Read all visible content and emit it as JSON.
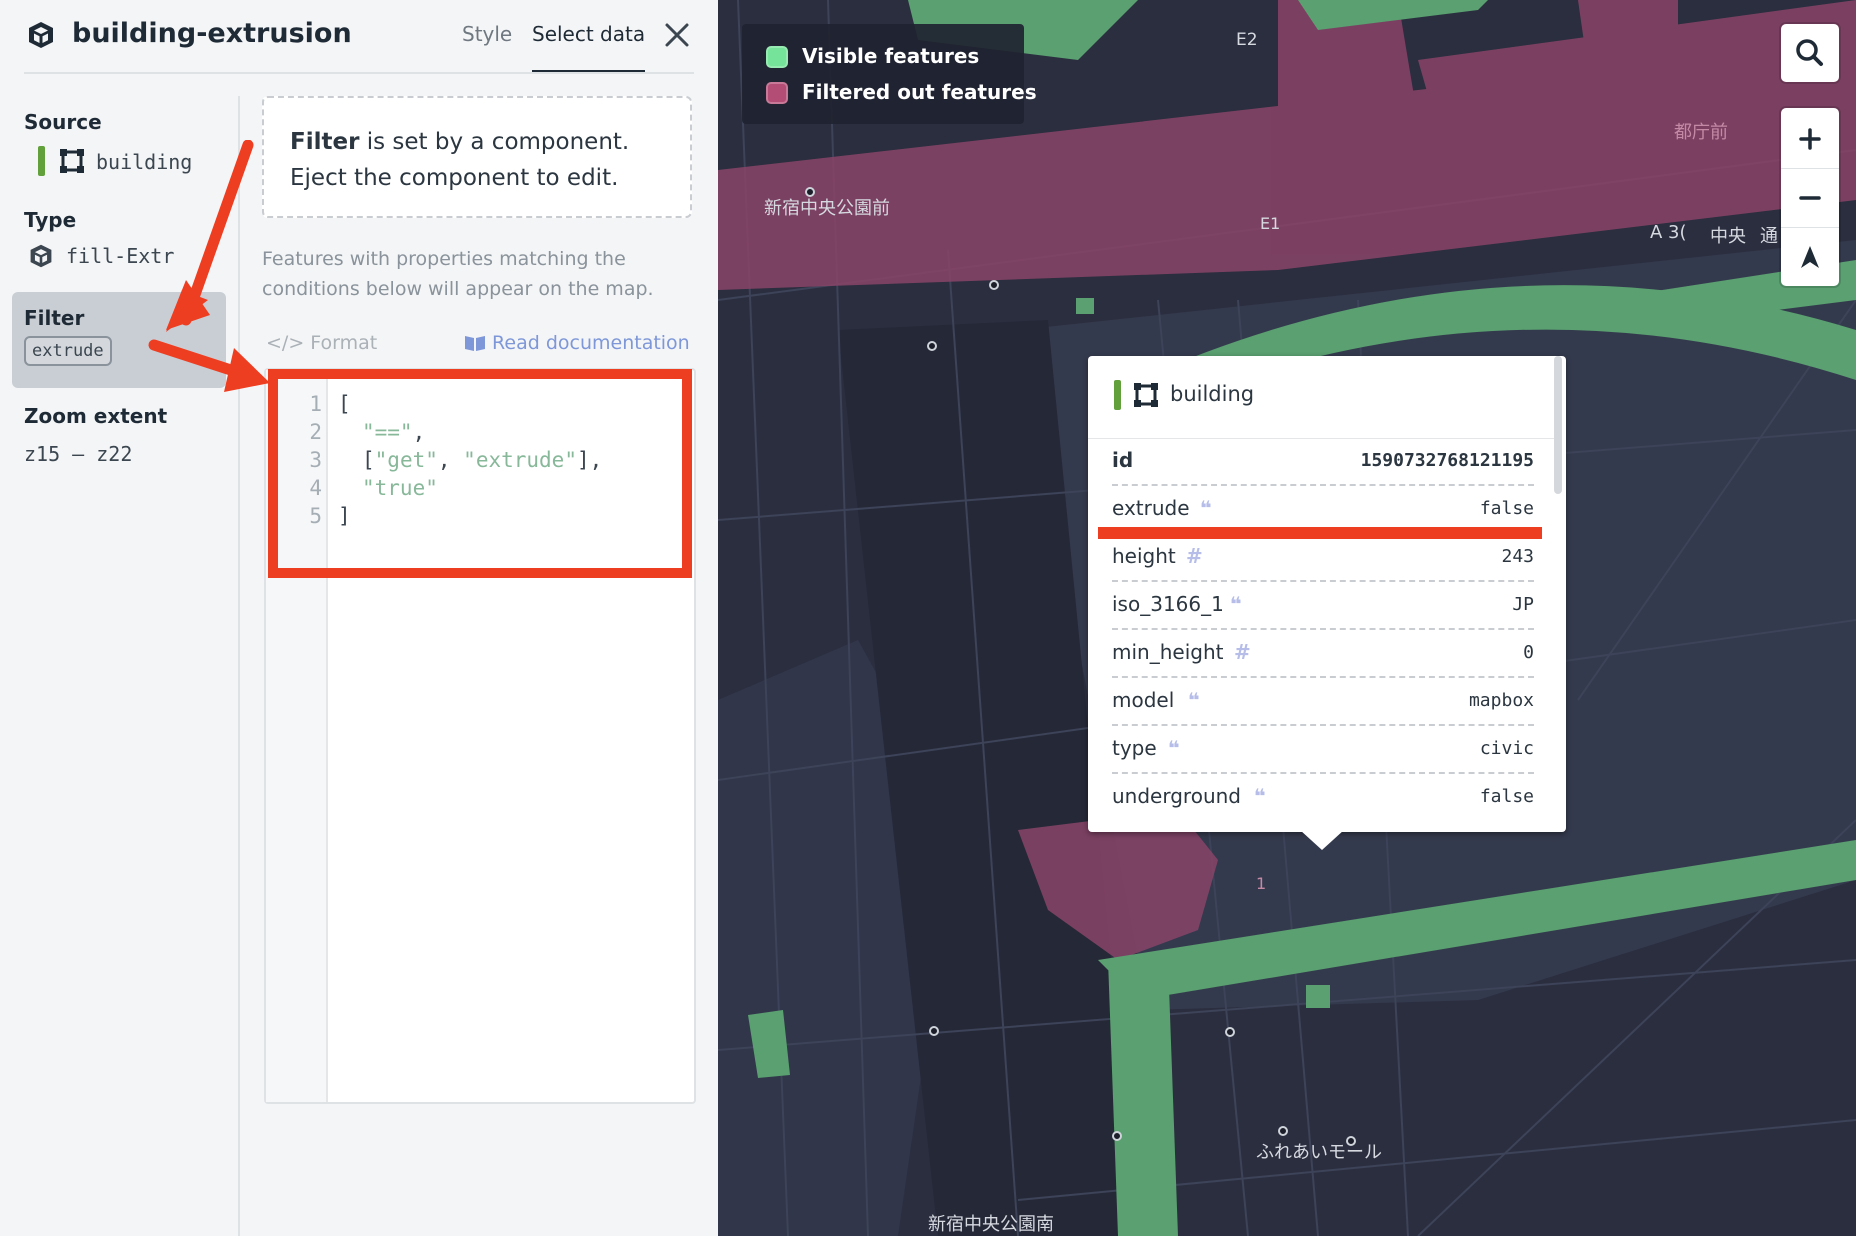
{
  "layer": {
    "title": "building-extrusion"
  },
  "tabs": {
    "style": "Style",
    "select_data": "Select data"
  },
  "icons": {
    "layer": "3d-cube-icon",
    "close": "close-icon",
    "polygon": "polygon-icon",
    "format": "code-icon",
    "docs": "book-icon"
  },
  "sidebar": {
    "source_label": "Source",
    "source_value": "building",
    "source_color": "#62a03b",
    "type_label": "Type",
    "type_value": "fill-Extr",
    "filter_label": "Filter",
    "filter_badge": "extrude",
    "zoom_label": "Zoom extent",
    "zoom_value": "z15 — z22"
  },
  "notice": {
    "bold": "Filter",
    "text_1": " is set by a component.",
    "text_2": "Eject the component to edit."
  },
  "help_text": "Features with properties matching the conditions below will appear on the map.",
  "toolbar": {
    "format": "Format",
    "docs": "Read documentation"
  },
  "code": {
    "line_numbers": [
      "1",
      "2",
      "3",
      "4",
      "5"
    ],
    "l1": "[",
    "l2_str": "\"==\"",
    "l2_rest": ",",
    "l3_open": "[",
    "l3_s1": "\"get\"",
    "l3_comma": ", ",
    "l3_s2": "\"extrude\"",
    "l3_close": "],",
    "l4_str": "\"true\"",
    "l5": "]"
  },
  "legend": {
    "visible": {
      "label": "Visible features",
      "color": "#76e39a"
    },
    "filtered": {
      "label": "Filtered out features",
      "color": "#b44d75"
    }
  },
  "map_labels": [
    "E2",
    "都庁前",
    "新宿中央公園前",
    "E1",
    "A 3(",
    "中央",
    "通",
    "ふれあいモール",
    "新宿中央公園南",
    "1"
  ],
  "popup": {
    "source": "building",
    "rows": [
      {
        "key": "id",
        "type": "",
        "value": "1590732768121195"
      },
      {
        "key": "extrude",
        "type": "❝",
        "value": "false"
      },
      {
        "key": "height",
        "type": "#",
        "value": "243"
      },
      {
        "key": "iso_3166_1",
        "type": "❝",
        "value": "JP"
      },
      {
        "key": "min_height",
        "type": "#",
        "value": "0"
      },
      {
        "key": "model",
        "type": "❝",
        "value": "mapbox"
      },
      {
        "key": "type",
        "type": "❝",
        "value": "civic"
      },
      {
        "key": "underground",
        "type": "❝",
        "value": "false"
      }
    ]
  },
  "controls": {
    "search": "search-icon",
    "zoom_in": "plus-icon",
    "zoom_out": "minus-icon",
    "compass": "compass-icon"
  }
}
